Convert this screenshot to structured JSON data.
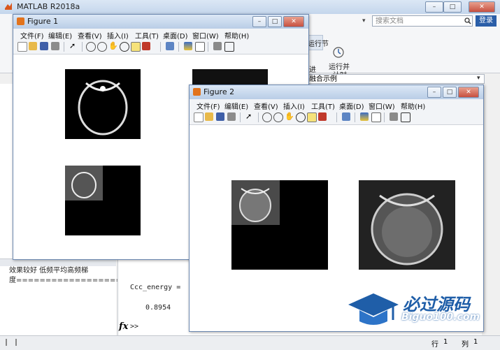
{
  "app": {
    "title": "MATLAB R2018a"
  },
  "header": {
    "search_placeholder": "搜索文档",
    "login_label": "登录",
    "ribbon": {
      "run_section_label": "运行节",
      "run_advance_label": "进",
      "run_time_label_1": "运行并",
      "run_time_label_2": "计时"
    }
  },
  "path": {
    "text": "融合示例"
  },
  "left_pane": {
    "line1": "效果较好 低频平均高频梯",
    "line2": "度=================="
  },
  "command_window": {
    "var_line": "Ccc_energy =",
    "value_line": "0.8954",
    "prompt": ">>"
  },
  "status_bar": {
    "row_label": "行",
    "row_value": "1",
    "col_label": "列",
    "col_value": "1"
  },
  "figure1": {
    "title": "Figure 1",
    "menu": [
      "文件(F)",
      "编辑(E)",
      "查看(V)",
      "插入(I)",
      "工具(T)",
      "桌面(D)",
      "窗口(W)",
      "帮助(H)"
    ]
  },
  "figure2": {
    "title": "Figure 2",
    "menu": [
      "文件(F)",
      "编辑(E)",
      "查看(V)",
      "插入(I)",
      "工具(T)",
      "桌面(D)",
      "窗口(W)",
      "帮助(H)"
    ]
  },
  "watermark": {
    "title": "必过源码",
    "url": "Biguo100.com"
  },
  "icons": [
    "matlab-logo-icon",
    "search-icon",
    "new-file-icon",
    "open-icon",
    "save-icon",
    "print-icon",
    "pointer-icon",
    "zoom-in-icon",
    "zoom-out-icon",
    "pan-icon",
    "rotate-icon",
    "datatip-icon",
    "brush-icon",
    "colorbar-icon",
    "legend-icon",
    "graduation-cap-icon"
  ]
}
